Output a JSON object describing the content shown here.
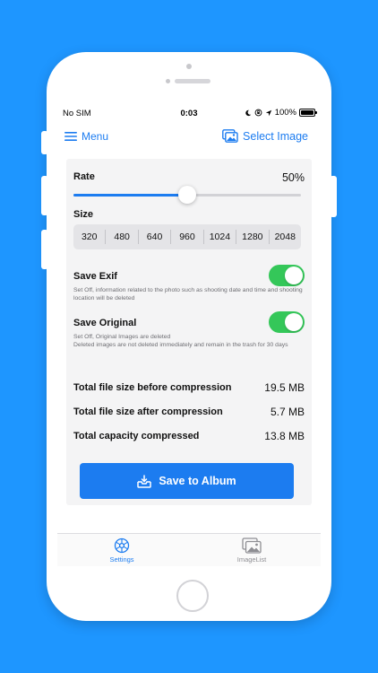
{
  "status_bar": {
    "carrier": "No SIM",
    "time": "0:03",
    "battery": "100%"
  },
  "nav": {
    "menu_label": "Menu",
    "select_image_label": "Select Image"
  },
  "rate": {
    "label": "Rate",
    "value_text": "50%",
    "value": 0.5
  },
  "size": {
    "label": "Size",
    "options": [
      "320",
      "480",
      "640",
      "960",
      "1024",
      "1280",
      "2048"
    ]
  },
  "save_exif": {
    "label": "Save Exif",
    "enabled": true,
    "description": "Set Off, information related to the photo such as shooting date and time and shooting location will be deleted"
  },
  "save_original": {
    "label": "Save Original",
    "enabled": true,
    "description_line1": "Set Off, Original Images are deleted",
    "description_line2": "Deleted images are not deleted immediately and remain in the trash for 30 days"
  },
  "stats": [
    {
      "label": "Total file size before compression",
      "value": "19.5 MB"
    },
    {
      "label": "Total file size after compression",
      "value": "5.7 MB"
    },
    {
      "label": "Total capacity compressed",
      "value": "13.8 MB"
    }
  ],
  "save_button_label": "Save to Album",
  "tabs": [
    {
      "label": "Settings",
      "active": true
    },
    {
      "label": "ImageList",
      "active": false
    }
  ],
  "colors": {
    "background": "#1e96ff",
    "accent": "#1c7cf0",
    "toggle_on": "#34c759"
  }
}
